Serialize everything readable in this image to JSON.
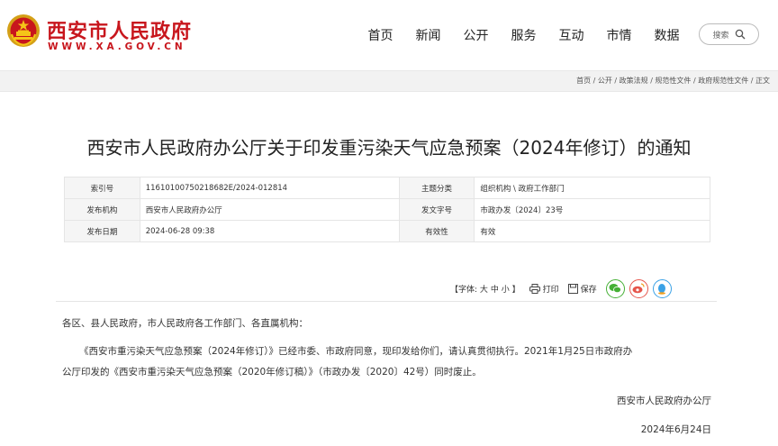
{
  "header": {
    "logo_title": "西安市人民政府",
    "logo_url": "WWW.XA.GOV.CN",
    "nav": [
      "首页",
      "新闻",
      "公开",
      "服务",
      "互动",
      "市情",
      "数据"
    ],
    "search_placeholder": "搜索"
  },
  "breadcrumb": "首页 / 公开 / 政策法规 / 规范性文件 / 政府规范性文件 / 正文",
  "doc": {
    "title": "西安市人民政府办公厅关于印发重污染天气应急预案（2024年修订）的通知",
    "meta": {
      "index_label": "索引号",
      "index_value": "11610100750218682E/2024-012814",
      "topic_label": "主题分类",
      "topic_value": "组织机构 \\ 政府工作部门",
      "issuer_label": "发布机构",
      "issuer_value": "西安市人民政府办公厅",
      "docno_label": "发文字号",
      "docno_value": "市政办发〔2024〕23号",
      "date_label": "发布日期",
      "date_value": "2024-06-28 09:38",
      "validity_label": "有效性",
      "validity_value": "有效"
    },
    "tools": {
      "font_prefix": "【字体:",
      "font_large": "大",
      "font_medium": "中",
      "font_small": "小",
      "font_suffix": "】",
      "print": "打印",
      "save": "保存"
    },
    "salutation": "各区、县人民政府，市人民政府各工作部门、各直属机构：",
    "para_line1": "《西安市重污染天气应急预案（2024年修订）》已经市委、市政府同意，现印发给你们，请认真贯彻执行。2021年1月25日市政府办",
    "para_line2": "公厅印发的《西安市重污染天气应急预案（2020年修订稿）》（市政办发〔2020〕42号）同时废止。",
    "signature": "西安市人民政府办公厅",
    "sign_date": "2024年6月24日"
  },
  "colors": {
    "brand_red": "#c8161d",
    "wechat": "#45b035",
    "weibo": "#e5554b",
    "qq": "#3aa1e6"
  },
  "icons": [
    "national-emblem-icon",
    "search-icon",
    "print-icon",
    "save-icon",
    "wechat-icon",
    "weibo-icon",
    "qq-icon"
  ]
}
